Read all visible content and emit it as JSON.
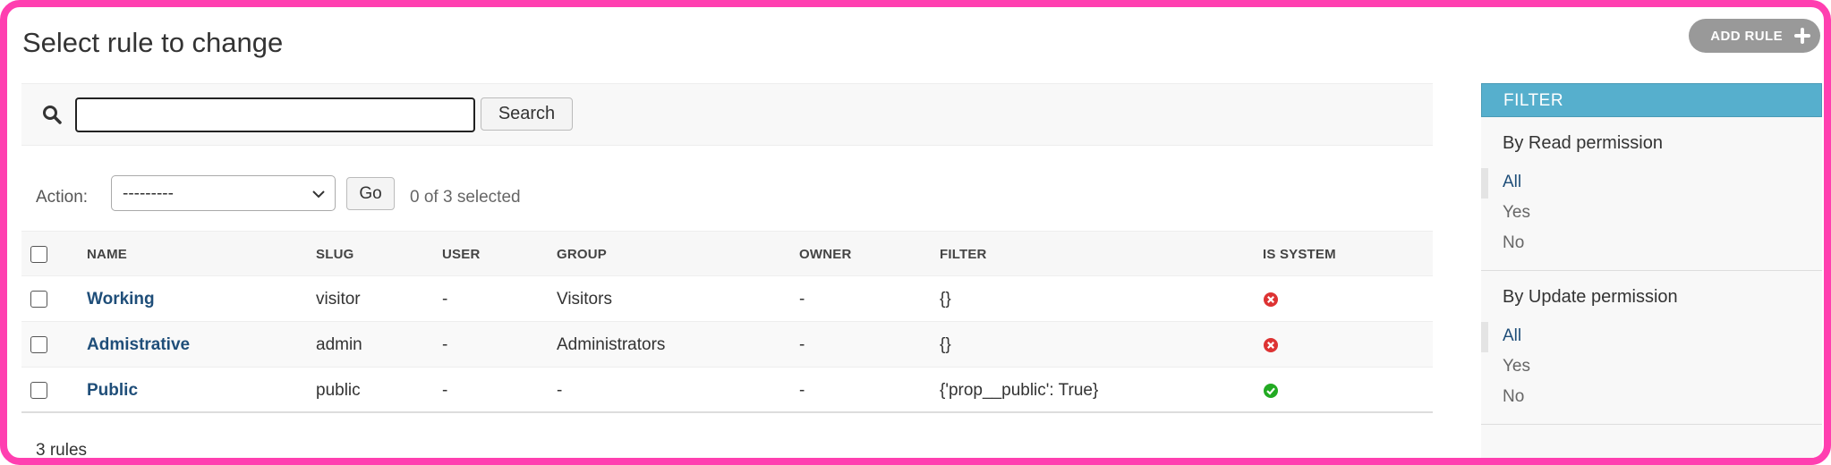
{
  "page": {
    "title": "Select rule to change"
  },
  "add_button": {
    "label": "ADD RULE"
  },
  "search": {
    "value": "",
    "button_label": "Search"
  },
  "actions": {
    "label": "Action:",
    "selected_option": "---------",
    "go_label": "Go",
    "selection_status": "0 of 3 selected"
  },
  "table": {
    "headers": {
      "name": "NAME",
      "slug": "SLUG",
      "user": "USER",
      "group": "GROUP",
      "owner": "OWNER",
      "filter": "FILTER",
      "is_system": "IS SYSTEM"
    },
    "rows": [
      {
        "name": "Working",
        "slug": "visitor",
        "user": "-",
        "group": "Visitors",
        "owner": "-",
        "filter": "{}",
        "is_system": "no"
      },
      {
        "name": "Admistrative",
        "slug": "admin",
        "user": "-",
        "group": "Administrators",
        "owner": "-",
        "filter": "{}",
        "is_system": "no"
      },
      {
        "name": "Public",
        "slug": "public",
        "user": "-",
        "group": "-",
        "owner": "-",
        "filter": "{'prop__public': True}",
        "is_system": "yes"
      }
    ]
  },
  "footer": {
    "count": "3 rules"
  },
  "sidebar": {
    "header": "FILTER",
    "groups": [
      {
        "title": "By Read permission",
        "options": [
          "All",
          "Yes",
          "No"
        ],
        "selected": "All"
      },
      {
        "title": "By Update permission",
        "options": [
          "All",
          "Yes",
          "No"
        ],
        "selected": "All"
      }
    ]
  },
  "colors": {
    "accent": "#56afcd",
    "link": "#1f4e79",
    "status_no": "#dd3333",
    "status_yes": "#22aa22",
    "frame": "#ff3fb0"
  },
  "icons": {
    "search": "search-icon",
    "add": "plus-icon",
    "dropdown": "chevron-down-icon",
    "status_no": "x-circle-icon",
    "status_yes": "check-circle-icon"
  }
}
